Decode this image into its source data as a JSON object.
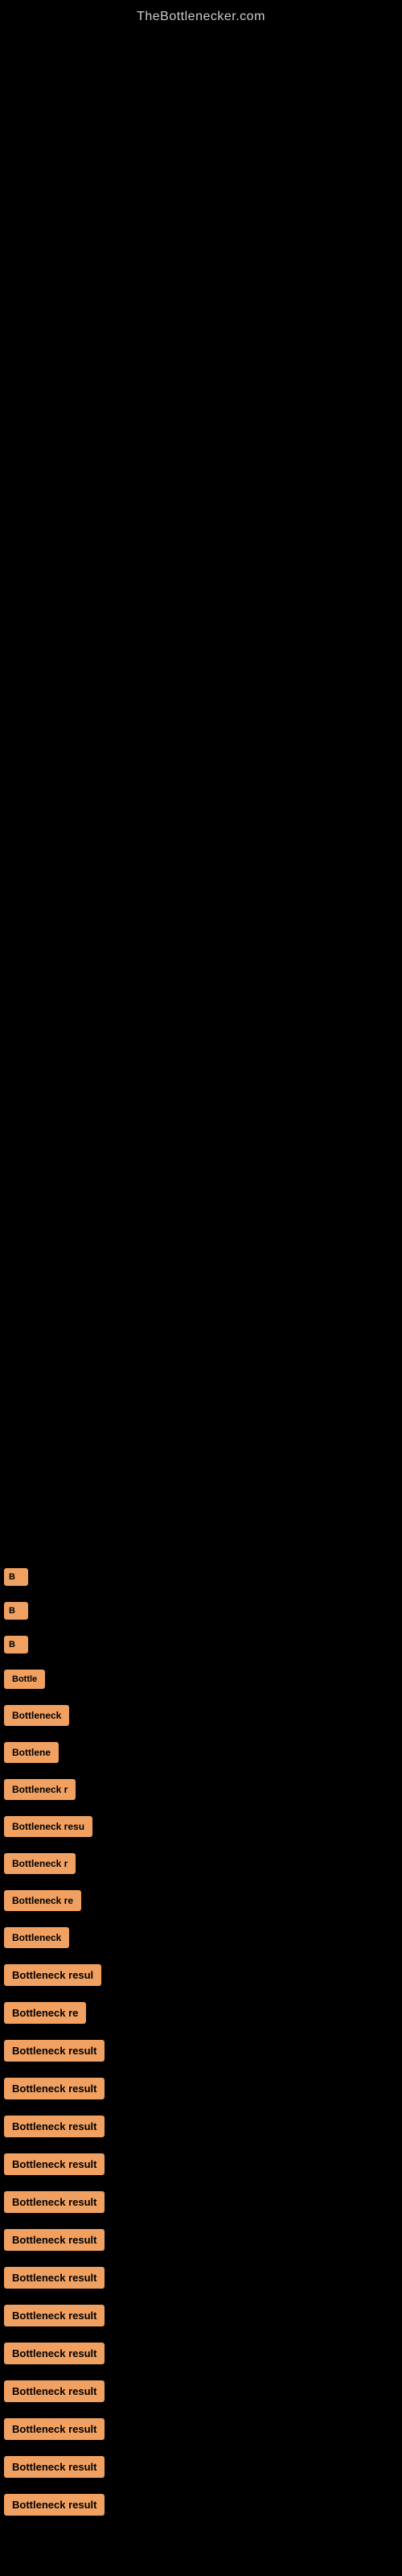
{
  "site": {
    "title": "TheBottlenecker.com"
  },
  "results": [
    {
      "label": "B"
    },
    {
      "label": "B"
    },
    {
      "label": "B"
    },
    {
      "label": "Bottle"
    },
    {
      "label": "Bottleneck"
    },
    {
      "label": "Bottlene"
    },
    {
      "label": "Bottleneck r"
    },
    {
      "label": "Bottleneck resu"
    },
    {
      "label": "Bottleneck r"
    },
    {
      "label": "Bottleneck re"
    },
    {
      "label": "Bottleneck"
    },
    {
      "label": "Bottleneck resul"
    },
    {
      "label": "Bottleneck re"
    },
    {
      "label": "Bottleneck result"
    },
    {
      "label": "Bottleneck result"
    },
    {
      "label": "Bottleneck result"
    },
    {
      "label": "Bottleneck result"
    },
    {
      "label": "Bottleneck result"
    },
    {
      "label": "Bottleneck result"
    },
    {
      "label": "Bottleneck result"
    },
    {
      "label": "Bottleneck result"
    },
    {
      "label": "Bottleneck result"
    },
    {
      "label": "Bottleneck result"
    },
    {
      "label": "Bottleneck result"
    },
    {
      "label": "Bottleneck result"
    },
    {
      "label": "Bottleneck result"
    }
  ]
}
